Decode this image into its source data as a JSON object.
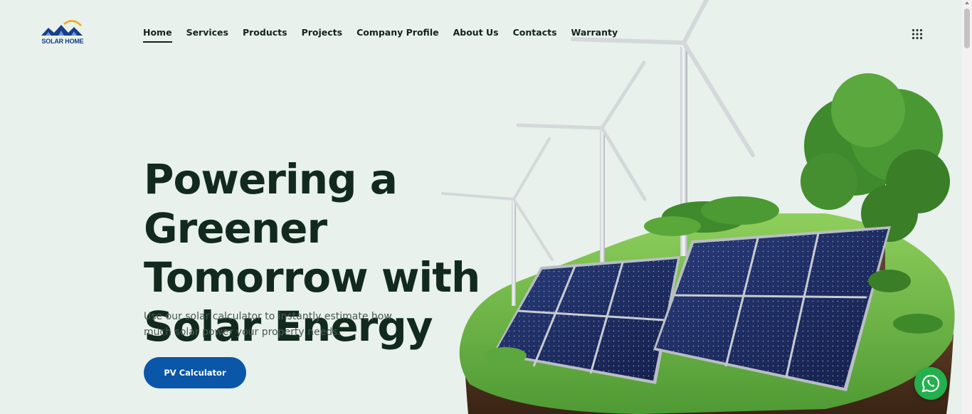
{
  "brand": {
    "logo_text": "SOLAR HOME",
    "logo_icon": "house-sun-logo-icon"
  },
  "nav": {
    "items": [
      {
        "label": "Home",
        "active": true
      },
      {
        "label": "Services",
        "active": false
      },
      {
        "label": "Products",
        "active": false
      },
      {
        "label": "Projects",
        "active": false
      },
      {
        "label": "Company Profile",
        "active": false
      },
      {
        "label": "About Us",
        "active": false
      },
      {
        "label": "Contacts",
        "active": false
      },
      {
        "label": "Warranty",
        "active": false
      }
    ],
    "menu_icon": "grid-dots-icon"
  },
  "hero": {
    "title_line1": "Powering a Greener",
    "title_line2": "Tomorrow with",
    "title_line3": "Solar Energy",
    "subtitle": "Use our solar calculator to instantly estimate how much solar power your property needs.",
    "cta_label": "PV Calculator"
  },
  "floating": {
    "whatsapp_icon": "whatsapp-icon"
  },
  "colors": {
    "background": "#e8f1eb",
    "heading": "#112a1d",
    "cta": "#0a56a8",
    "whatsapp": "#22b14c",
    "logo": "#173f8a"
  }
}
